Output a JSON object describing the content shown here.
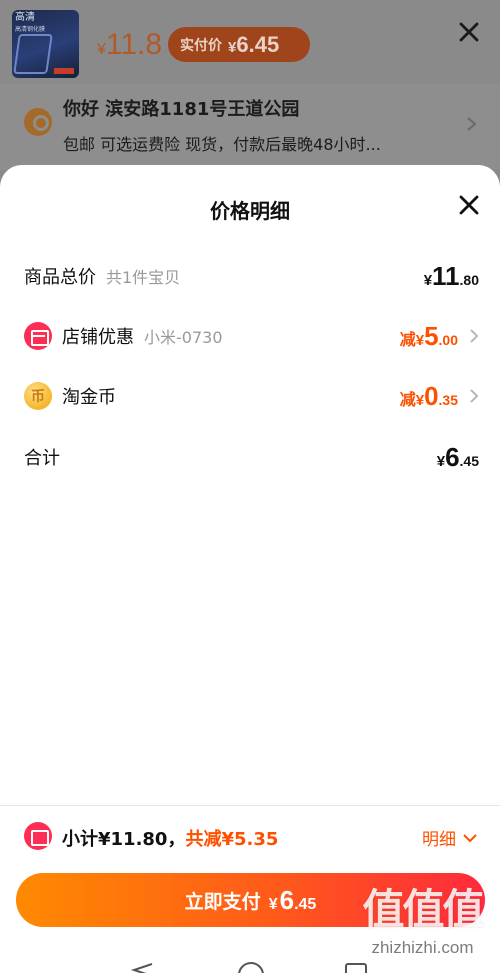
{
  "background": {
    "product_thumb": {
      "line1": "高清",
      "line2": "高清钢化膜"
    },
    "price": {
      "yen": "¥",
      "value": "11.8"
    },
    "actual_price_badge": {
      "label": "实付价",
      "yen": "¥",
      "int": "6",
      "dec": ".45"
    },
    "address": {
      "greeting": "你好 滨安路1181号王道公园",
      "detail": "包邮 可选运费险 现货，付款后最晚48小时..."
    }
  },
  "sheet": {
    "title": "价格明细",
    "rows": [
      {
        "label": "商品总价",
        "sub": "共1件宝贝",
        "yen": "¥",
        "int": "11",
        "dec": ".80"
      },
      {
        "label": "店铺优惠",
        "sub": "小米-0730",
        "prefix": "减",
        "yen": "¥",
        "int": "5",
        "dec": ".00"
      },
      {
        "label": "淘金币",
        "sub": "",
        "prefix": "减",
        "yen": "¥",
        "int": "0",
        "dec": ".35",
        "coin_glyph": "币"
      },
      {
        "label": "合计",
        "sub": "",
        "yen": "¥",
        "int": "6",
        "dec": ".45"
      }
    ]
  },
  "summary": {
    "subtotal": "小计¥11.80，",
    "saved": "共减¥5.35",
    "detail_label": "明细"
  },
  "pay_button": {
    "label": "立即支付",
    "yen": "¥",
    "int": "6",
    "dec": ".45"
  },
  "watermark": {
    "glyphs": "值值值",
    "domain": "zhizhizhi.com"
  },
  "colors": {
    "accent": "#ff5000",
    "store_icon": "#ff2c54",
    "coin": "#f6b42a"
  }
}
